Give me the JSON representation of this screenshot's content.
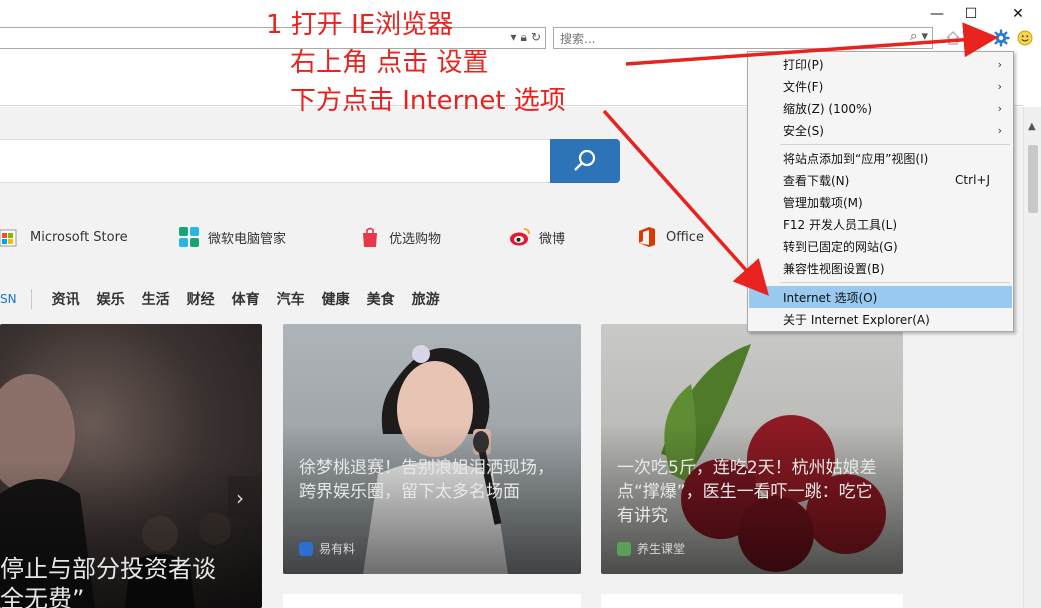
{
  "window": {
    "minimize_glyph": "—",
    "maximize_glyph": "☐",
    "close_glyph": "✕"
  },
  "toolbar": {
    "search_placeholder": "搜索...",
    "search_icon": "magnifier-icon",
    "settings_icon": "gear-icon",
    "smiley_icon": "smiley-icon",
    "home_icon": "home-icon",
    "favorites_icon": "star-icon"
  },
  "bing": {
    "search_icon": "magnifier-icon"
  },
  "quick_links": [
    {
      "label": "Microsoft Store",
      "icon": "store-icon"
    },
    {
      "label": "微软电脑管家",
      "icon": "pc-manager-icon"
    },
    {
      "label": "优选购物",
      "icon": "shopping-bag-icon"
    },
    {
      "label": "微博",
      "icon": "weibo-icon"
    },
    {
      "label": "Office",
      "icon": "office-icon"
    }
  ],
  "nav": {
    "msn_label": "SN",
    "categories": [
      "资讯",
      "娱乐",
      "生活",
      "财经",
      "体育",
      "汽车",
      "健康",
      "美食",
      "旅游"
    ]
  },
  "cards": [
    {
      "title": "停止与部分投资者谈\n全无费”",
      "source": ""
    },
    {
      "title": "徐梦桃退赛！告别浪姐泪洒现场，跨界娱乐圈，留下太多名场面",
      "source": "易有料"
    },
    {
      "title": "一次吃5斤，连吃2天！杭州姑娘差点“撑爆”，医生一看吓一跳：吃它有讲究",
      "source": "养生课堂"
    }
  ],
  "menu": {
    "items": [
      {
        "label": "打印(P)",
        "arrow": "›",
        "shortcut": ""
      },
      {
        "label": "文件(F)",
        "arrow": "›",
        "shortcut": ""
      },
      {
        "label": "缩放(Z) (100%)",
        "arrow": "›",
        "shortcut": ""
      },
      {
        "label": "安全(S)",
        "arrow": "›",
        "shortcut": ""
      },
      {
        "label": "将站点添加到“应用”视图(I)",
        "arrow": "",
        "shortcut": ""
      },
      {
        "label": "查看下载(N)",
        "arrow": "",
        "shortcut": "Ctrl+J"
      },
      {
        "label": "管理加载项(M)",
        "arrow": "",
        "shortcut": ""
      },
      {
        "label": "F12 开发人员工具(L)",
        "arrow": "",
        "shortcut": ""
      },
      {
        "label": "转到已固定的网站(G)",
        "arrow": "",
        "shortcut": ""
      },
      {
        "label": "兼容性视图设置(B)",
        "arrow": "",
        "shortcut": ""
      },
      {
        "label": "Internet 选项(O)",
        "arrow": "",
        "shortcut": "",
        "highlighted": true
      },
      {
        "label": "关于 Internet Explorer(A)",
        "arrow": "",
        "shortcut": ""
      }
    ]
  },
  "annotation": {
    "line1": "1 打开 IE浏览器",
    "line2": "右上角 点击 设置",
    "line3": "下方点击 Internet 选项",
    "color": "#e8231f"
  },
  "colors": {
    "highlight": "#99c9ef",
    "bing_blue": "#2c73b8",
    "link_blue": "#1a73c8"
  }
}
